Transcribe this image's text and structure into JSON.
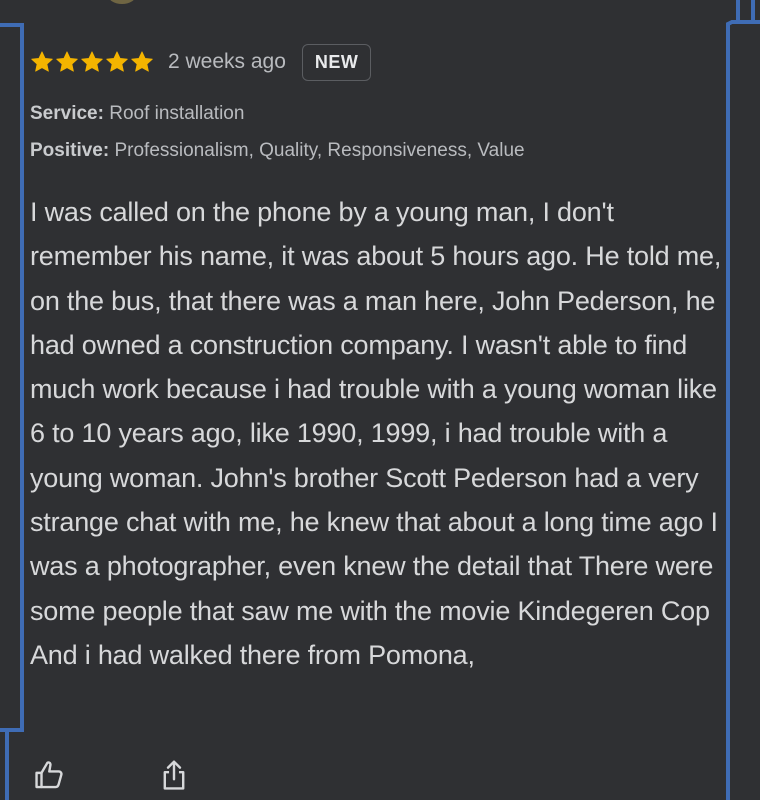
{
  "review": {
    "rating": 5,
    "rating_max": 5,
    "time_ago": "2 weeks ago",
    "badge": "NEW",
    "service_label": "Service:",
    "service_value": "Roof installation",
    "positive_label": "Positive:",
    "positive_value": "Professionalism, Quality, Responsiveness, Value",
    "text": "I was called on the phone by a young man, I don't remember his name, it was about 5 hours ago. He told me, on the bus, that there was a man here, John Pederson, he had owned a construction company. I wasn't able to find much work because i had trouble with a young woman like 6 to 10 years ago, like 1990, 1999, i had trouble with a young woman. John's brother Scott Pederson had a very strange chat with me, he knew that about a long time ago I was a photographer, even knew the detail that There were some people that saw me with the movie Kindegeren Cop And i had walked there from Pomona,"
  },
  "actions": {
    "like_icon": "thumbs-up-icon",
    "share_icon": "share-icon"
  },
  "colors": {
    "background": "#2f3033",
    "star": "#f4b400",
    "focus_border": "#3f6cb5",
    "text": "#d7d8da",
    "muted_text": "#b9bbbf"
  }
}
